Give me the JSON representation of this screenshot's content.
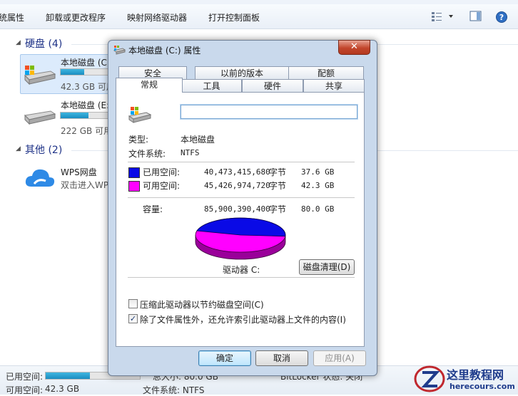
{
  "toolbar": {
    "items": [
      "统属性",
      "卸载或更改程序",
      "映射网络驱动器",
      "打开控制面板"
    ]
  },
  "explorer": {
    "groups": {
      "hard_disks": "硬盘 (4)",
      "other": "其他 (2)"
    },
    "drives": [
      {
        "name": "本地磁盘 (C:",
        "size": "42.3 GB 可用",
        "used_fraction": 0.47
      },
      {
        "name": "本地磁盘 (E:",
        "size": "222 GB 可用",
        "used_fraction": 0.55
      }
    ],
    "other_items": [
      {
        "name": "WPS网盘",
        "subtitle": "双击进入WP"
      }
    ]
  },
  "statusbar": {
    "used_label": "已用空间:",
    "free_label": "可用空间:",
    "free_value": "42.3 GB",
    "used_fraction": 0.47,
    "total": "总大小: 80.0 GB",
    "filesystem": "文件系统: NTFS",
    "bitlocker": "BitLocker 状态: 关闭"
  },
  "dialog": {
    "title": "本地磁盘 (C:) 属性",
    "close": "✕",
    "tabs_back": [
      "安全",
      "以前的版本",
      "配额"
    ],
    "tabs_front": [
      "常规",
      "工具",
      "硬件",
      "共享"
    ],
    "name_value": "",
    "type_label": "类型:",
    "type_value": "本地磁盘",
    "fs_label": "文件系统:",
    "fs_value": "NTFS",
    "used": {
      "label": "已用空间:",
      "bytes": "40,473,415,680",
      "unit": "字节",
      "human": "37.6 GB",
      "color": "#0a0ae6"
    },
    "free": {
      "label": "可用空间:",
      "bytes": "45,426,974,720",
      "unit": "字节",
      "human": "42.3 GB",
      "color": "#ff00ff"
    },
    "capacity": {
      "label": "容量:",
      "bytes": "85,900,390,400",
      "unit": "字节",
      "human": "80.0 GB"
    },
    "drive_label": "驱动器 C:",
    "cleanup_button": "磁盘清理(D)",
    "compress_label": "压缩此驱动器以节约磁盘空间(C)",
    "compress_checked": false,
    "index_label": "除了文件属性外，还允许索引此驱动器上文件的内容(I)",
    "index_checked": true,
    "ok": "确定",
    "cancel": "取消",
    "apply": "应用(A)"
  },
  "watermark": {
    "title": "这里教程网",
    "url": "herecours.com"
  }
}
